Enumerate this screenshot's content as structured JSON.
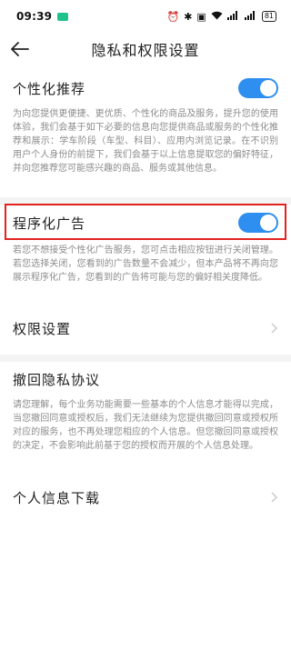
{
  "status": {
    "time": "09:39",
    "battery": "81"
  },
  "nav": {
    "title": "隐私和权限设置"
  },
  "items": {
    "personalized": {
      "title": "个性化推荐",
      "enabled": true,
      "desc": "为向您提供更便捷、更优质、个性化的商品及服务，提升您的使用体验，我们会基于如下必要的信息向您提供商品或服务的个性化推荐和展示：学车阶段（车型、科目）、应用内浏览记录。在不识别用户个人身份的前提下，我们会基于以上信息提取您的偏好特征，并向您推荐您可能感兴趣的商品、服务或其他信息。"
    },
    "programmatic_ads": {
      "title": "程序化广告",
      "enabled": true,
      "desc": "若您不想接受个性化广告服务，您可点击相应按钮进行关闭管理。若您选择关闭，您看到的广告数量不会减少，但本产品将不再向您展示程序化广告，您看到的广告将可能与您的偏好相关度降低。"
    },
    "permissions": {
      "title": "权限设置"
    },
    "revoke": {
      "title": "撤回隐私协议",
      "desc": "请您理解，每个业务功能需要一些基本的个人信息才能得以完成，当您撤回同意或授权后，我们无法继续为您提供撤回同意或授权所对应的服务，也不再处理您相应的个人信息。但您撤回同意或授权的决定，不会影响此前基于您的授权而开展的个人信息处理。"
    },
    "download": {
      "title": "个人信息下载"
    }
  },
  "colors": {
    "accent": "#2e8ff0",
    "highlight": "#e3231f"
  },
  "icons": {
    "back": "back-arrow-icon",
    "chevron": "chevron-right-icon"
  }
}
